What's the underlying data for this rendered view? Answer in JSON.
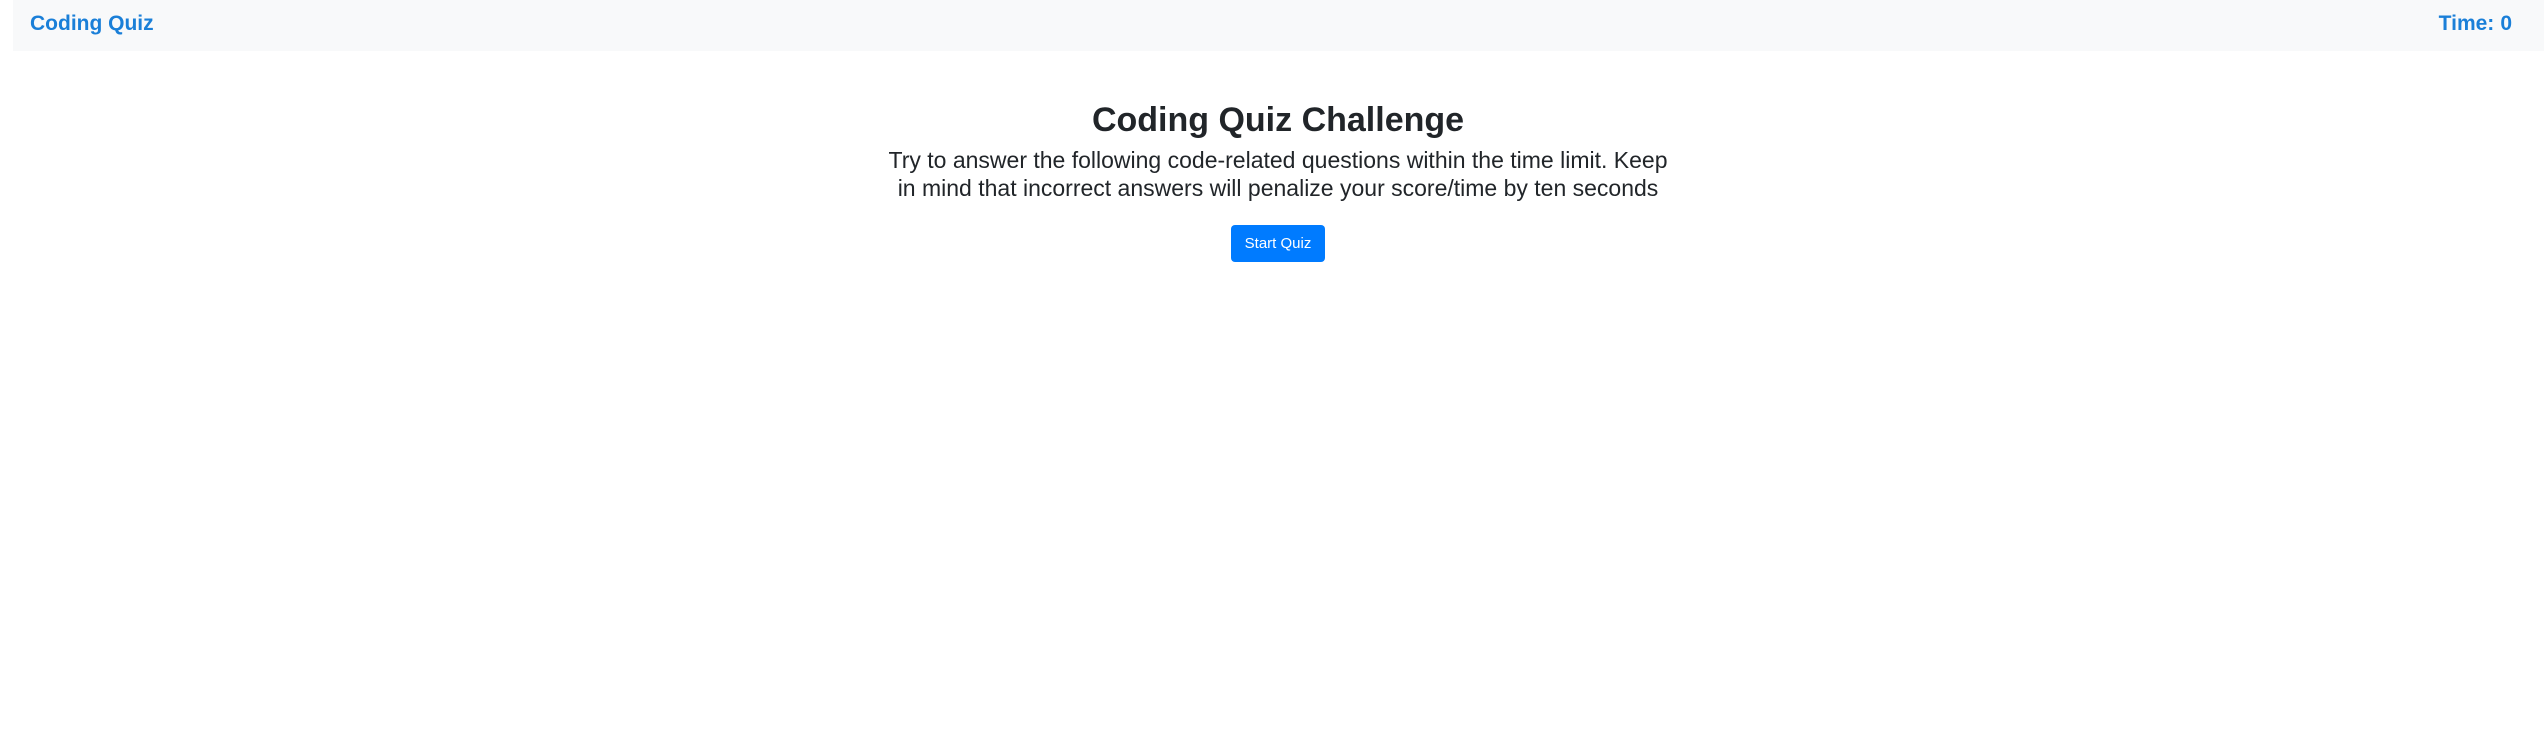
{
  "navbar": {
    "brand": "Coding Quiz",
    "timer_label": "Time:",
    "timer_value": "0"
  },
  "hero": {
    "title": "Coding Quiz Challenge",
    "intro": "Try to answer the following code-related questions within the time limit. Keep in mind that incorrect answers will penalize your score/time by ten seconds",
    "start_label": "Start Quiz"
  },
  "colors": {
    "brand_link": "#1a7fd8",
    "navbar_bg": "#f8f9fa",
    "primary_button": "#007bff",
    "text": "#212529"
  }
}
